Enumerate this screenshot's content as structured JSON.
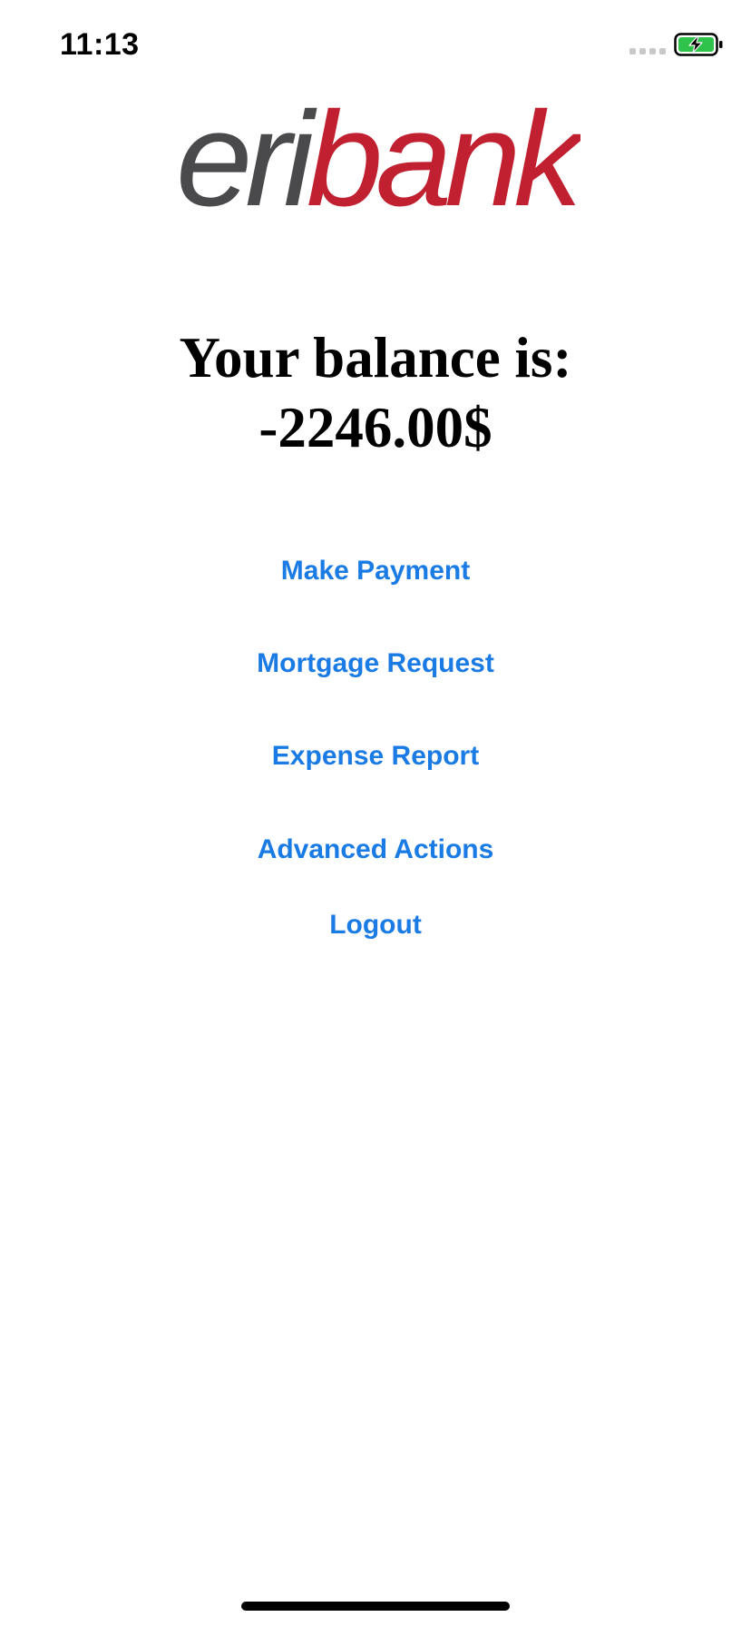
{
  "status_bar": {
    "time": "11:13",
    "signal_icon": "signal-dots-icon",
    "battery_icon": "battery-charging-icon",
    "battery_color": "#2fc34c"
  },
  "logo": {
    "text_part1": "eri",
    "text_part2": "bank",
    "color_part1": "#4a4a4c",
    "color_part2": "#c0202f"
  },
  "balance": {
    "label": "Your balance is:",
    "amount": "-2246.00$"
  },
  "actions": {
    "make_payment": "Make Payment",
    "mortgage_request": "Mortgage Request",
    "expense_report": "Expense Report",
    "advanced_actions": "Advanced Actions",
    "logout": "Logout"
  },
  "colors": {
    "accent": "#1a7be4",
    "background": "#ffffff"
  }
}
